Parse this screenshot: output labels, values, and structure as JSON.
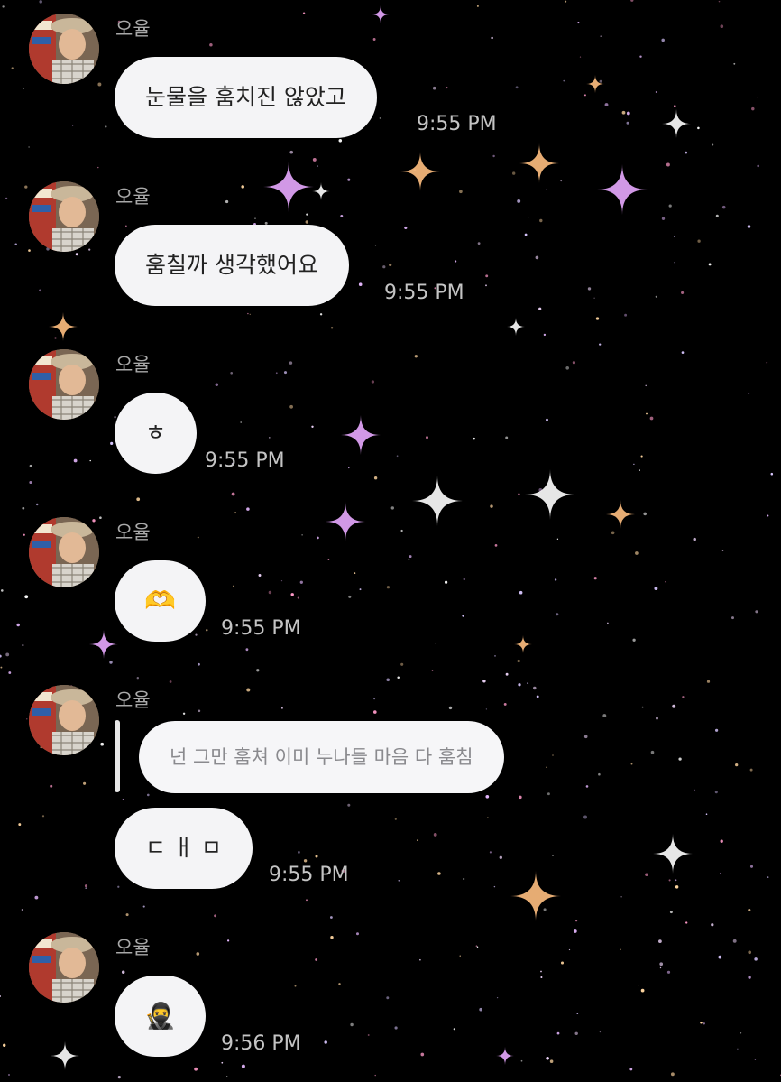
{
  "background_color": "#000000",
  "bubble_color": "#f4f4f6",
  "messages": [
    {
      "sender": "오율",
      "text": "눈물을 훔치진 않았고",
      "time": "9:55 PM"
    },
    {
      "sender": "오율",
      "text": "훔칠까 생각했어요",
      "time": "9:55 PM"
    },
    {
      "sender": "오율",
      "text": "ㅎ",
      "time": "9:55 PM"
    },
    {
      "sender": "오율",
      "text": "🫶",
      "time": "9:55 PM"
    },
    {
      "sender": "오율",
      "reply_to": "넌 그만 훔쳐 이미 누나들 마음 다 훔침",
      "text": "ㄷ ㅐ ㅁ",
      "time": "9:55 PM"
    },
    {
      "sender": "오율",
      "text": "🥷",
      "time": "9:56 PM"
    }
  ]
}
